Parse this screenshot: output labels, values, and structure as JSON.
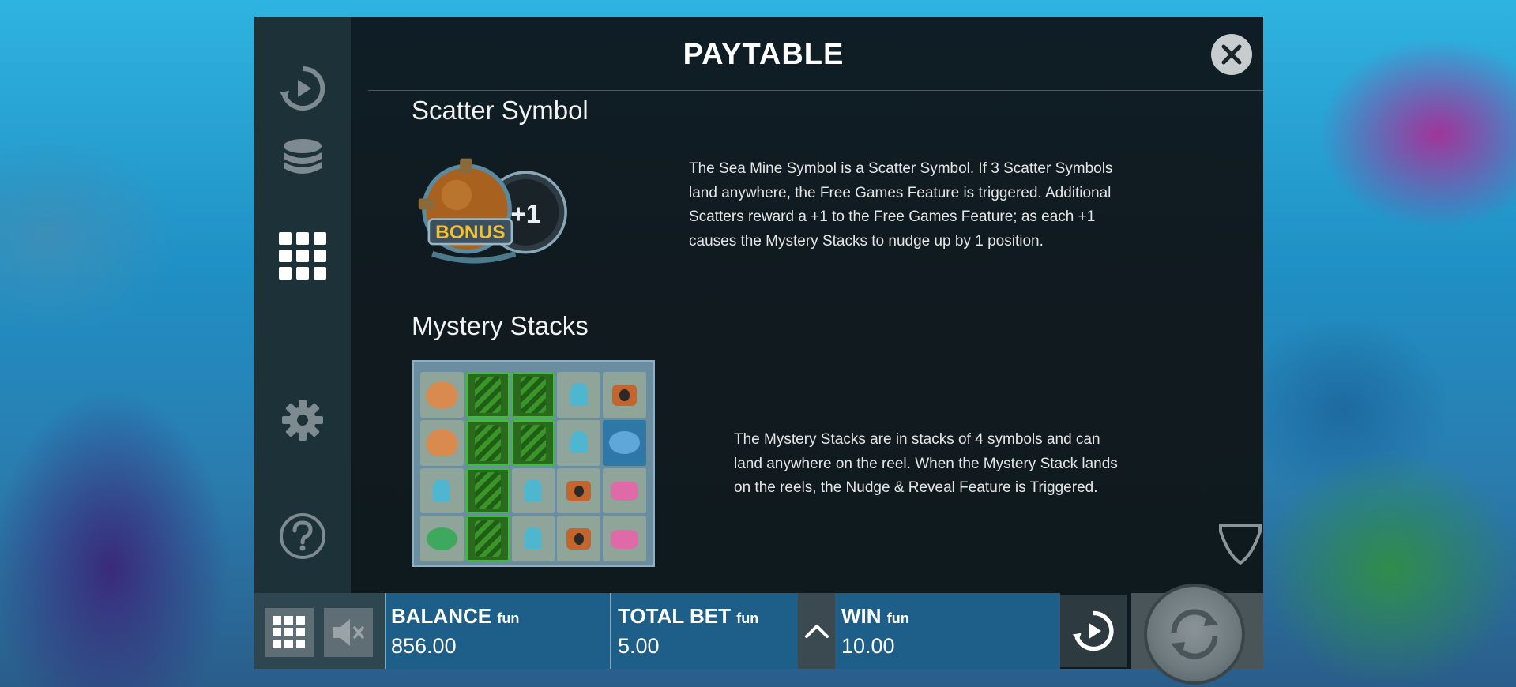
{
  "header": {
    "title": "PAYTABLE",
    "close_icon": "close-icon"
  },
  "sidebar": {
    "items": [
      {
        "icon": "autoplay-icon"
      },
      {
        "icon": "coins-icon"
      },
      {
        "icon": "paytable-grid-icon",
        "active": true
      },
      {
        "icon": "settings-gear-icon"
      },
      {
        "icon": "help-question-icon"
      }
    ]
  },
  "sections": {
    "scatter": {
      "title": "Scatter Symbol",
      "lines": [
        "The Sea Mine Symbol is a Scatter Symbol. If 3 Scatter Symbols",
        "land anywhere, the Free Games Feature is triggered. Additional",
        "Scatters reward a +1 to the Free Games Feature; as each +1",
        "causes the Mystery Stacks to nudge up by 1 position."
      ],
      "image_text": {
        "bonus": "BONUS",
        "plus_one": "+1"
      }
    },
    "mystery": {
      "title": "Mystery Stacks",
      "lines": [
        "The Mystery Stacks are in stacks of 4 symbols and can",
        "land anywhere on the reel. When the Mystery Stack lands",
        "on the reels, the Nudge & Reveal Feature is Triggered."
      ]
    }
  },
  "bottom_bar": {
    "balance": {
      "label": "BALANCE",
      "suffix": "fun",
      "value": "856.00"
    },
    "total_bet": {
      "label": "TOTAL BET",
      "suffix": "fun",
      "value": "5.00"
    },
    "win": {
      "label": "WIN",
      "suffix": "fun",
      "value": "10.00"
    }
  },
  "colors": {
    "panel": "#0d1a21",
    "sidebar": "#1d3138",
    "info_bar": "#1e5f8a",
    "text": "#ffffff"
  }
}
